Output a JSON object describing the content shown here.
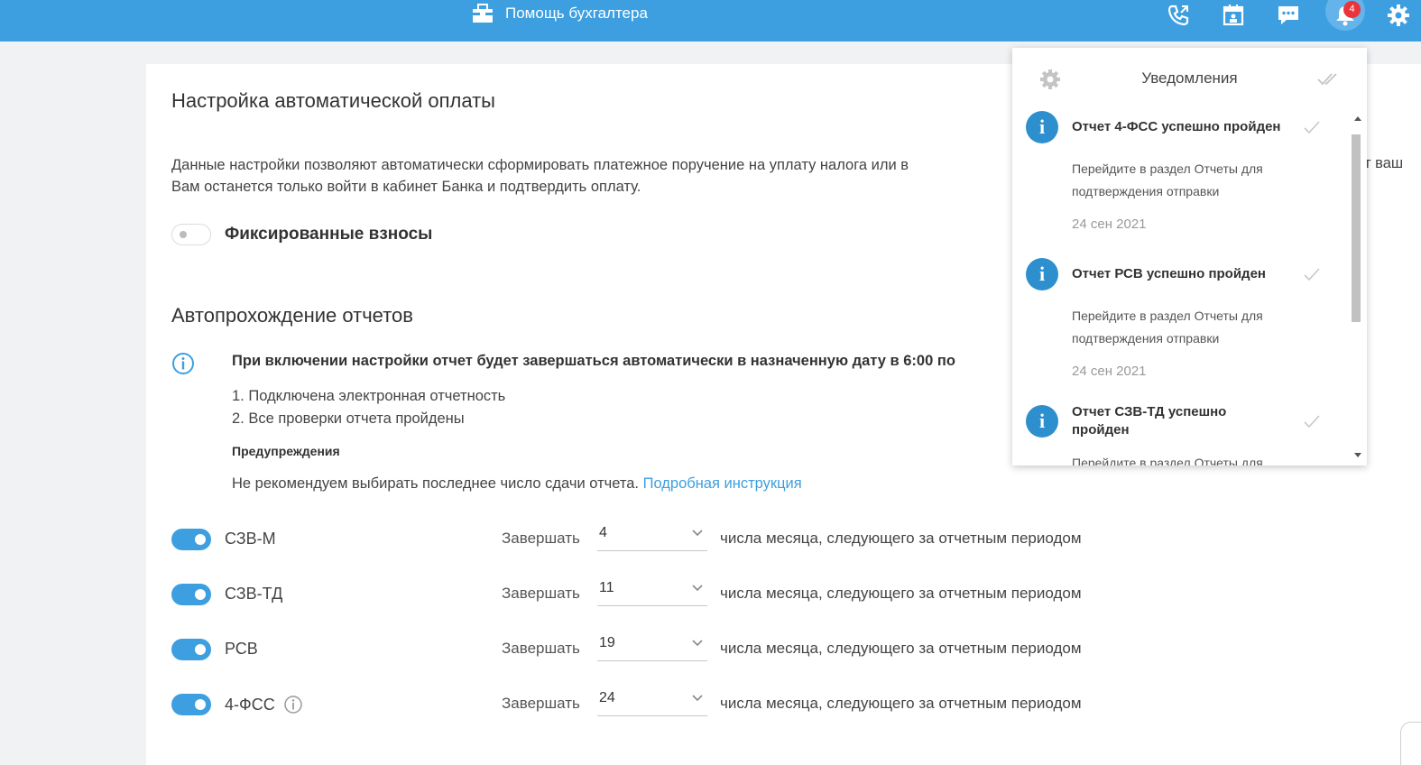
{
  "topbar": {
    "title": "Помощь бухгалтера",
    "badge_count": "4",
    "bg_color": "#3d9fe0",
    "icons": [
      "briefcase-icon",
      "phone-icon",
      "calendar-icon",
      "chat-icon",
      "bell-icon",
      "gear-icon"
    ]
  },
  "main": {
    "heading": "Настройка автоматической оплаты",
    "description_line1": "Данные настройки позволяют автоматически сформировать платежное поручение на уплату налога или в",
    "description_line2": "Вам останется только войти в кабинет Банка и подтвердить оплату.",
    "description_clipped_right": "т ваш",
    "fixed_toggle_label": "Фиксированные взносы",
    "auto_heading": "Автопрохождение отчетов",
    "auto_note": "При включении настройки отчет будет завершаться автоматически в назначенную дату в 6:00 по",
    "conditions": [
      "1. Подключена электронная отчетность",
      "2. Все проверки отчета пройдены"
    ],
    "warnings_title": "Предупреждения",
    "warning_text": "Не рекомендуем выбирать последнее число сдачи отчета.",
    "warning_link": "Подробная инструкция",
    "rows": [
      {
        "name": "СЗВ-М",
        "finish_label": "Завершать",
        "day": "4",
        "tail": "числа месяца, следующего за отчетным периодом",
        "enabled": true
      },
      {
        "name": "СЗВ-ТД",
        "finish_label": "Завершать",
        "day": "11",
        "tail": "числа месяца, следующего за отчетным периодом",
        "enabled": true
      },
      {
        "name": "РСВ",
        "finish_label": "Завершать",
        "day": "19",
        "tail": "числа месяца, следующего за отчетным периодом",
        "enabled": true
      },
      {
        "name": "4-ФСС",
        "finish_label": "Завершать",
        "day": "24",
        "tail": "числа месяца, следующего за отчетным периодом",
        "enabled": true
      }
    ]
  },
  "notifications": {
    "title": "Уведомления",
    "items": [
      {
        "title": "Отчет 4-ФСС успешно пройден",
        "text_line1": "Перейдите в раздел Отчеты для",
        "text_line2": "подтверждения отправки",
        "date": "24 сен 2021"
      },
      {
        "title": "Отчет РСВ успешно пройден",
        "text_line1": "Перейдите в раздел Отчеты для",
        "text_line2": "подтверждения отправки",
        "date": "24 сен 2021"
      },
      {
        "title": "Отчет СЗВ-ТД успешно пройден",
        "text_line1": "Перейдите в раздел Отчеты для",
        "text_line2": "",
        "date": ""
      }
    ]
  }
}
